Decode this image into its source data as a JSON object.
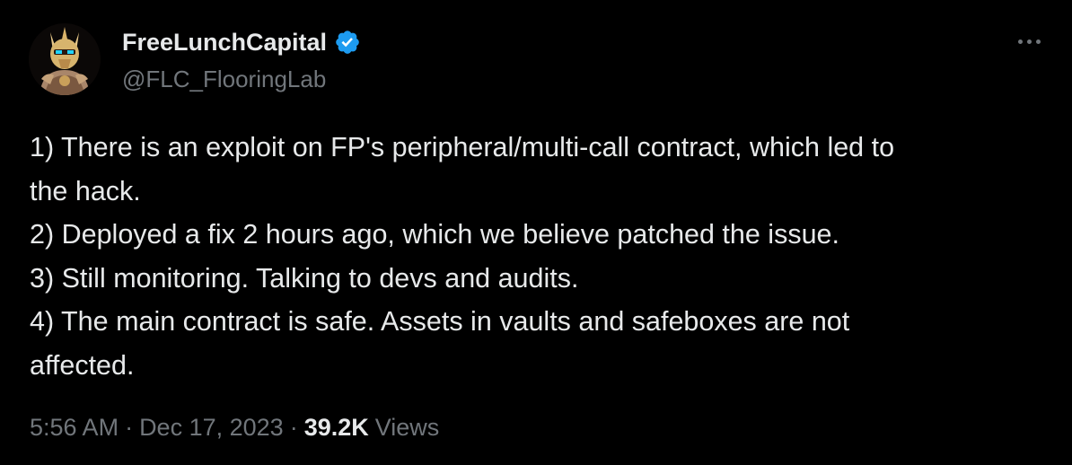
{
  "author": {
    "display_name": "FreeLunchCapital",
    "handle": "@FLC_FlooringLab",
    "verified": true,
    "verified_color": "#1d9bf0"
  },
  "more_icon": "more-horizontal-icon",
  "tweet": {
    "lines": [
      "1) There is an exploit on FP's peripheral/multi-call contract, which led to",
      "the hack.",
      "2) Deployed a fix 2 hours ago, which we believe patched the issue.",
      "3) Still monitoring. Talking to devs and audits.",
      "4) The main contract is safe. Assets in vaults and safeboxes are not",
      "affected."
    ]
  },
  "meta": {
    "time": "5:56 AM",
    "separator": "·",
    "date": "Dec 17, 2023",
    "views_count": "39.2K",
    "views_label": "Views"
  },
  "colors": {
    "background": "#000000",
    "text_primary": "#e7e9ea",
    "text_secondary": "#71767b"
  }
}
